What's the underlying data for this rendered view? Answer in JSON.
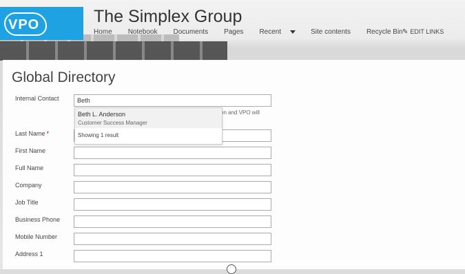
{
  "site": {
    "logo_text": "VPO",
    "title": "The Simplex Group"
  },
  "nav": {
    "items": [
      "Home",
      "Notebook",
      "Documents",
      "Pages",
      "Recent",
      "Site contents",
      "Recycle Bin"
    ],
    "edit_links": "EDIT LINKS"
  },
  "page": {
    "title": "Global Directory"
  },
  "form": {
    "internal_contact": {
      "label": "Internal Contact",
      "value": "Beth"
    },
    "help_text": "on and VPO will",
    "fields": [
      {
        "label": "Last Name",
        "required": "*",
        "value": ""
      },
      {
        "label": "First Name",
        "value": ""
      },
      {
        "label": "Full Name",
        "value": ""
      },
      {
        "label": "Company",
        "value": ""
      },
      {
        "label": "Job Title",
        "value": ""
      },
      {
        "label": "Business Phone",
        "value": ""
      },
      {
        "label": "Mobile Number",
        "value": ""
      },
      {
        "label": "Address 1",
        "value": ""
      }
    ]
  },
  "picker": {
    "suggestion_name": "Beth L. Anderson",
    "suggestion_role": "Customer Success Manager",
    "count_text": "Showing 1 result"
  },
  "icons": {
    "pencil": "pencil-icon",
    "dropdown_caret": "chevron-down-icon",
    "logo": "vpo-logo"
  },
  "colors": {
    "logo_background": "#1fa2e1",
    "required_marker": "#cc0000"
  }
}
